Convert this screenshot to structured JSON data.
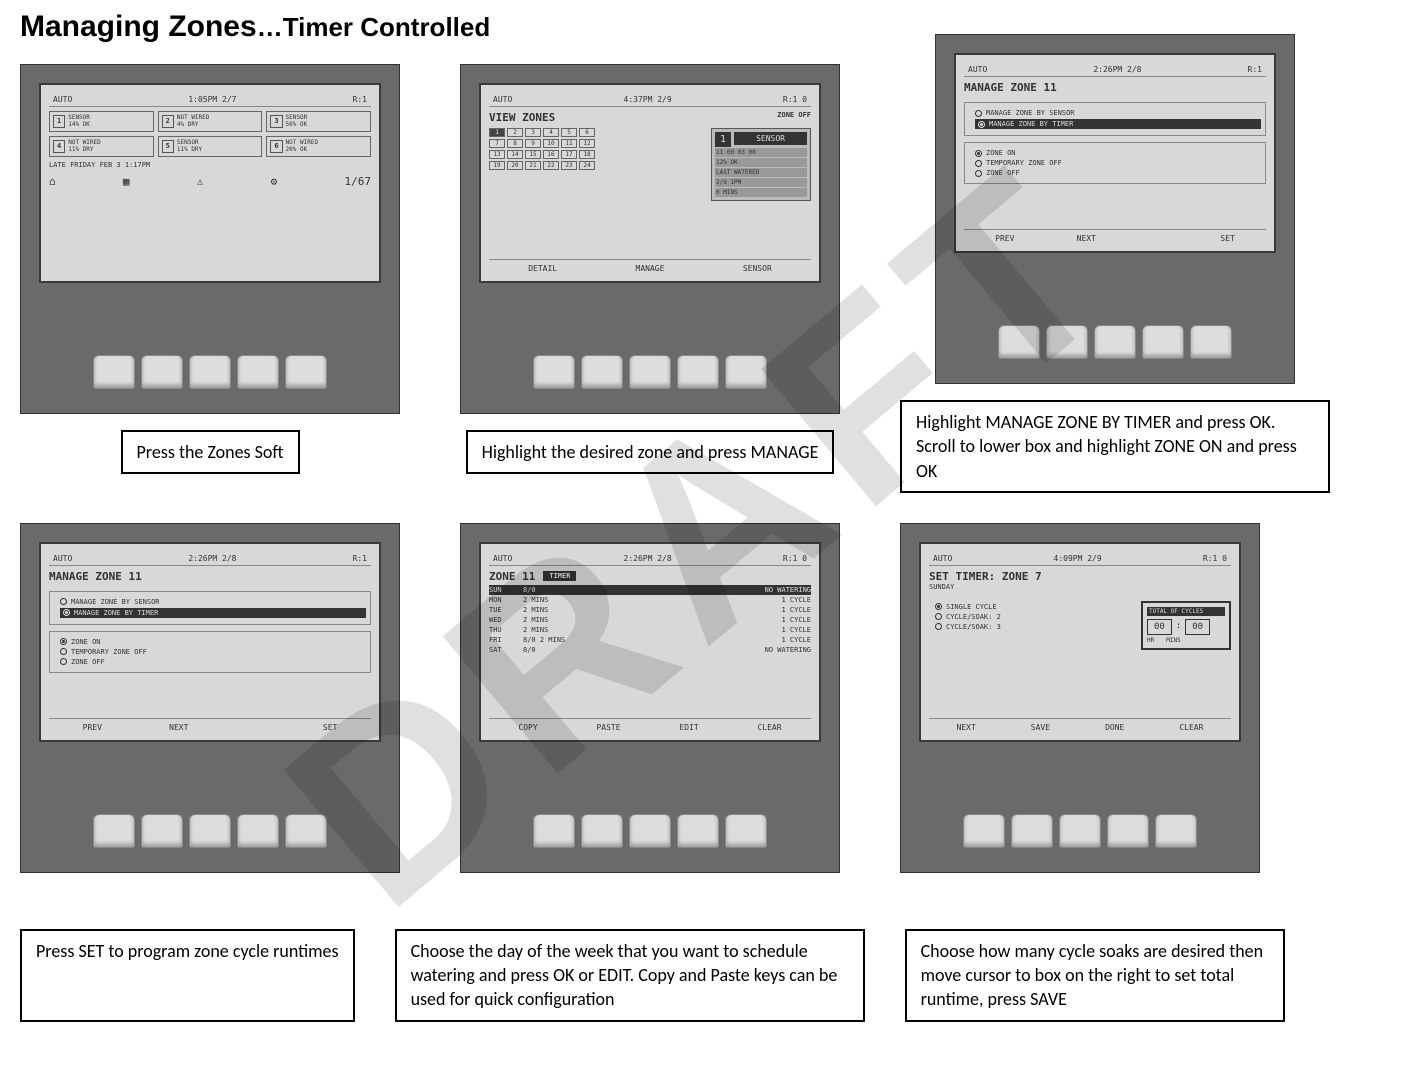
{
  "title_main": "Managing Zones",
  "title_sub": "…Timer Controlled",
  "watermark": "DRAFT",
  "steps": [
    {
      "hdr_left": "AUTO",
      "hdr_mid": "1:05PM 2/7",
      "hdr_right": "R:1",
      "zones": [
        {
          "n": "1",
          "l1": "SENSOR",
          "l2": "14% OK"
        },
        {
          "n": "2",
          "l1": "NOT WIRED",
          "l2": "4% DRY"
        },
        {
          "n": "3",
          "l1": "SENSOR",
          "l2": "50% OK"
        },
        {
          "n": "4",
          "l1": "NOT WIRED",
          "l2": "11% DRY"
        },
        {
          "n": "5",
          "l1": "SENSOR",
          "l2": "11% DRY"
        },
        {
          "n": "6",
          "l1": "NOT WIRED",
          "l2": "20% OK"
        }
      ],
      "last": "LATE FRIDAY    FEB 3    1:17PM",
      "footer_icons": [
        "⌂",
        "▦",
        "⚠",
        "⚙",
        "1/67"
      ],
      "caption": "Press the Zones Soft"
    },
    {
      "hdr_left": "AUTO",
      "hdr_mid": "4:37PM 2/9",
      "hdr_right": "R:1  0",
      "title": "VIEW ZONES",
      "zone_off": "ZONE OFF",
      "sel_zone": "1",
      "sensor": "SENSOR",
      "reading": "11 00 03 00",
      "pct": "12% OK",
      "last_lbl": "LAST WATERED",
      "last_val": "2/9 1PM",
      "mins": "0 MINS",
      "softkeys": [
        "DETAIL",
        "MANAGE",
        "SENSOR"
      ],
      "caption": "Highlight the desired zone and press MANAGE"
    },
    {
      "hdr_left": "AUTO",
      "hdr_mid": "2:26PM 2/8",
      "hdr_right": "R:1",
      "title": "MANAGE ZONE 11",
      "opts1": [
        "MANAGE ZONE BY SENSOR",
        "MANAGE ZONE BY TIMER"
      ],
      "hl1": 1,
      "opts2": [
        "ZONE ON",
        "TEMPORARY ZONE OFF",
        "ZONE OFF"
      ],
      "hl2": 0,
      "softkeys": [
        "PREV",
        "NEXT",
        "",
        "SET"
      ],
      "caption": "Highlight MANAGE ZONE BY TIMER and press OK. Scroll to lower box and highlight ZONE ON and press OK"
    },
    {
      "hdr_left": "AUTO",
      "hdr_mid": "2:26PM 2/8",
      "hdr_right": "R:1",
      "title": "MANAGE ZONE 11",
      "opts1": [
        "MANAGE ZONE BY SENSOR",
        "MANAGE ZONE BY TIMER"
      ],
      "hl1": 1,
      "opts2": [
        "ZONE ON",
        "TEMPORARY ZONE OFF",
        "ZONE OFF"
      ],
      "hl2": 0,
      "softkeys": [
        "PREV",
        "NEXT",
        "",
        "SET"
      ],
      "caption": "Press SET to program zone cycle runtimes"
    },
    {
      "hdr_left": "AUTO",
      "hdr_mid": "2:26PM 2/8",
      "hdr_right": "R:1  0",
      "title": "ZONE 11",
      "pill": "TIMER",
      "rows": [
        {
          "d": "SUN",
          "m": "8/0",
          "c": "NO WATERING",
          "hl": true
        },
        {
          "d": "MON",
          "m": "2 MINS",
          "c": "1 CYCLE"
        },
        {
          "d": "TUE",
          "m": "2 MINS",
          "c": "1 CYCLE"
        },
        {
          "d": "WED",
          "m": "2 MINS",
          "c": "1 CYCLE"
        },
        {
          "d": "THU",
          "m": "2 MINS",
          "c": "1 CYCLE"
        },
        {
          "d": "FRI",
          "m": "8/0   2 MINS",
          "c": "1 CYCLE"
        },
        {
          "d": "SAT",
          "m": "8/0",
          "c": "NO WATERING"
        }
      ],
      "softkeys": [
        "COPY",
        "PASTE",
        "EDIT",
        "CLEAR"
      ],
      "caption": "Choose the day of the week that you want to schedule watering and press OK or EDIT. Copy and Paste keys can be used for quick configuration"
    },
    {
      "hdr_left": "AUTO",
      "hdr_mid": "4:09PM 2/9",
      "hdr_right": "R:1  0",
      "title": "SET TIMER: ZONE 7",
      "sub": "SUNDAY",
      "opts": [
        "SINGLE CYCLE",
        "CYCLE/SOAK: 2",
        "CYCLE/SOAK: 3"
      ],
      "sel": 0,
      "box_lbl": "TOTAL OF CYCLES",
      "hr": "00",
      "mn": "00",
      "hr_lbl": "HR",
      "mn_lbl": "MINS",
      "softkeys": [
        "NEXT",
        "SAVE",
        "DONE",
        "CLEAR"
      ],
      "caption": "Choose how many cycle soaks are desired then move cursor to box on the right to set total runtime, press SAVE"
    }
  ]
}
